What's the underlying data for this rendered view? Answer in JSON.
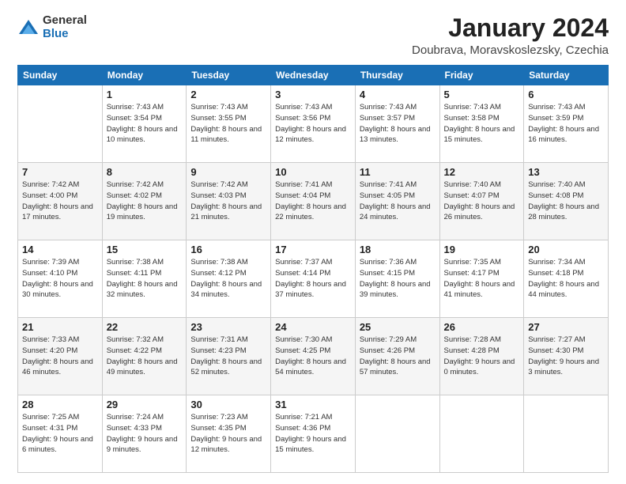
{
  "logo": {
    "general": "General",
    "blue": "Blue"
  },
  "title": "January 2024",
  "subtitle": "Doubrava, Moravskoslezsky, Czechia",
  "weekdays": [
    "Sunday",
    "Monday",
    "Tuesday",
    "Wednesday",
    "Thursday",
    "Friday",
    "Saturday"
  ],
  "weeks": [
    [
      {
        "day": "",
        "sunrise": "",
        "sunset": "",
        "daylight": ""
      },
      {
        "day": "1",
        "sunrise": "Sunrise: 7:43 AM",
        "sunset": "Sunset: 3:54 PM",
        "daylight": "Daylight: 8 hours and 10 minutes."
      },
      {
        "day": "2",
        "sunrise": "Sunrise: 7:43 AM",
        "sunset": "Sunset: 3:55 PM",
        "daylight": "Daylight: 8 hours and 11 minutes."
      },
      {
        "day": "3",
        "sunrise": "Sunrise: 7:43 AM",
        "sunset": "Sunset: 3:56 PM",
        "daylight": "Daylight: 8 hours and 12 minutes."
      },
      {
        "day": "4",
        "sunrise": "Sunrise: 7:43 AM",
        "sunset": "Sunset: 3:57 PM",
        "daylight": "Daylight: 8 hours and 13 minutes."
      },
      {
        "day": "5",
        "sunrise": "Sunrise: 7:43 AM",
        "sunset": "Sunset: 3:58 PM",
        "daylight": "Daylight: 8 hours and 15 minutes."
      },
      {
        "day": "6",
        "sunrise": "Sunrise: 7:43 AM",
        "sunset": "Sunset: 3:59 PM",
        "daylight": "Daylight: 8 hours and 16 minutes."
      }
    ],
    [
      {
        "day": "7",
        "sunrise": "Sunrise: 7:42 AM",
        "sunset": "Sunset: 4:00 PM",
        "daylight": "Daylight: 8 hours and 17 minutes."
      },
      {
        "day": "8",
        "sunrise": "Sunrise: 7:42 AM",
        "sunset": "Sunset: 4:02 PM",
        "daylight": "Daylight: 8 hours and 19 minutes."
      },
      {
        "day": "9",
        "sunrise": "Sunrise: 7:42 AM",
        "sunset": "Sunset: 4:03 PM",
        "daylight": "Daylight: 8 hours and 21 minutes."
      },
      {
        "day": "10",
        "sunrise": "Sunrise: 7:41 AM",
        "sunset": "Sunset: 4:04 PM",
        "daylight": "Daylight: 8 hours and 22 minutes."
      },
      {
        "day": "11",
        "sunrise": "Sunrise: 7:41 AM",
        "sunset": "Sunset: 4:05 PM",
        "daylight": "Daylight: 8 hours and 24 minutes."
      },
      {
        "day": "12",
        "sunrise": "Sunrise: 7:40 AM",
        "sunset": "Sunset: 4:07 PM",
        "daylight": "Daylight: 8 hours and 26 minutes."
      },
      {
        "day": "13",
        "sunrise": "Sunrise: 7:40 AM",
        "sunset": "Sunset: 4:08 PM",
        "daylight": "Daylight: 8 hours and 28 minutes."
      }
    ],
    [
      {
        "day": "14",
        "sunrise": "Sunrise: 7:39 AM",
        "sunset": "Sunset: 4:10 PM",
        "daylight": "Daylight: 8 hours and 30 minutes."
      },
      {
        "day": "15",
        "sunrise": "Sunrise: 7:38 AM",
        "sunset": "Sunset: 4:11 PM",
        "daylight": "Daylight: 8 hours and 32 minutes."
      },
      {
        "day": "16",
        "sunrise": "Sunrise: 7:38 AM",
        "sunset": "Sunset: 4:12 PM",
        "daylight": "Daylight: 8 hours and 34 minutes."
      },
      {
        "day": "17",
        "sunrise": "Sunrise: 7:37 AM",
        "sunset": "Sunset: 4:14 PM",
        "daylight": "Daylight: 8 hours and 37 minutes."
      },
      {
        "day": "18",
        "sunrise": "Sunrise: 7:36 AM",
        "sunset": "Sunset: 4:15 PM",
        "daylight": "Daylight: 8 hours and 39 minutes."
      },
      {
        "day": "19",
        "sunrise": "Sunrise: 7:35 AM",
        "sunset": "Sunset: 4:17 PM",
        "daylight": "Daylight: 8 hours and 41 minutes."
      },
      {
        "day": "20",
        "sunrise": "Sunrise: 7:34 AM",
        "sunset": "Sunset: 4:18 PM",
        "daylight": "Daylight: 8 hours and 44 minutes."
      }
    ],
    [
      {
        "day": "21",
        "sunrise": "Sunrise: 7:33 AM",
        "sunset": "Sunset: 4:20 PM",
        "daylight": "Daylight: 8 hours and 46 minutes."
      },
      {
        "day": "22",
        "sunrise": "Sunrise: 7:32 AM",
        "sunset": "Sunset: 4:22 PM",
        "daylight": "Daylight: 8 hours and 49 minutes."
      },
      {
        "day": "23",
        "sunrise": "Sunrise: 7:31 AM",
        "sunset": "Sunset: 4:23 PM",
        "daylight": "Daylight: 8 hours and 52 minutes."
      },
      {
        "day": "24",
        "sunrise": "Sunrise: 7:30 AM",
        "sunset": "Sunset: 4:25 PM",
        "daylight": "Daylight: 8 hours and 54 minutes."
      },
      {
        "day": "25",
        "sunrise": "Sunrise: 7:29 AM",
        "sunset": "Sunset: 4:26 PM",
        "daylight": "Daylight: 8 hours and 57 minutes."
      },
      {
        "day": "26",
        "sunrise": "Sunrise: 7:28 AM",
        "sunset": "Sunset: 4:28 PM",
        "daylight": "Daylight: 9 hours and 0 minutes."
      },
      {
        "day": "27",
        "sunrise": "Sunrise: 7:27 AM",
        "sunset": "Sunset: 4:30 PM",
        "daylight": "Daylight: 9 hours and 3 minutes."
      }
    ],
    [
      {
        "day": "28",
        "sunrise": "Sunrise: 7:25 AM",
        "sunset": "Sunset: 4:31 PM",
        "daylight": "Daylight: 9 hours and 6 minutes."
      },
      {
        "day": "29",
        "sunrise": "Sunrise: 7:24 AM",
        "sunset": "Sunset: 4:33 PM",
        "daylight": "Daylight: 9 hours and 9 minutes."
      },
      {
        "day": "30",
        "sunrise": "Sunrise: 7:23 AM",
        "sunset": "Sunset: 4:35 PM",
        "daylight": "Daylight: 9 hours and 12 minutes."
      },
      {
        "day": "31",
        "sunrise": "Sunrise: 7:21 AM",
        "sunset": "Sunset: 4:36 PM",
        "daylight": "Daylight: 9 hours and 15 minutes."
      },
      {
        "day": "",
        "sunrise": "",
        "sunset": "",
        "daylight": ""
      },
      {
        "day": "",
        "sunrise": "",
        "sunset": "",
        "daylight": ""
      },
      {
        "day": "",
        "sunrise": "",
        "sunset": "",
        "daylight": ""
      }
    ]
  ]
}
